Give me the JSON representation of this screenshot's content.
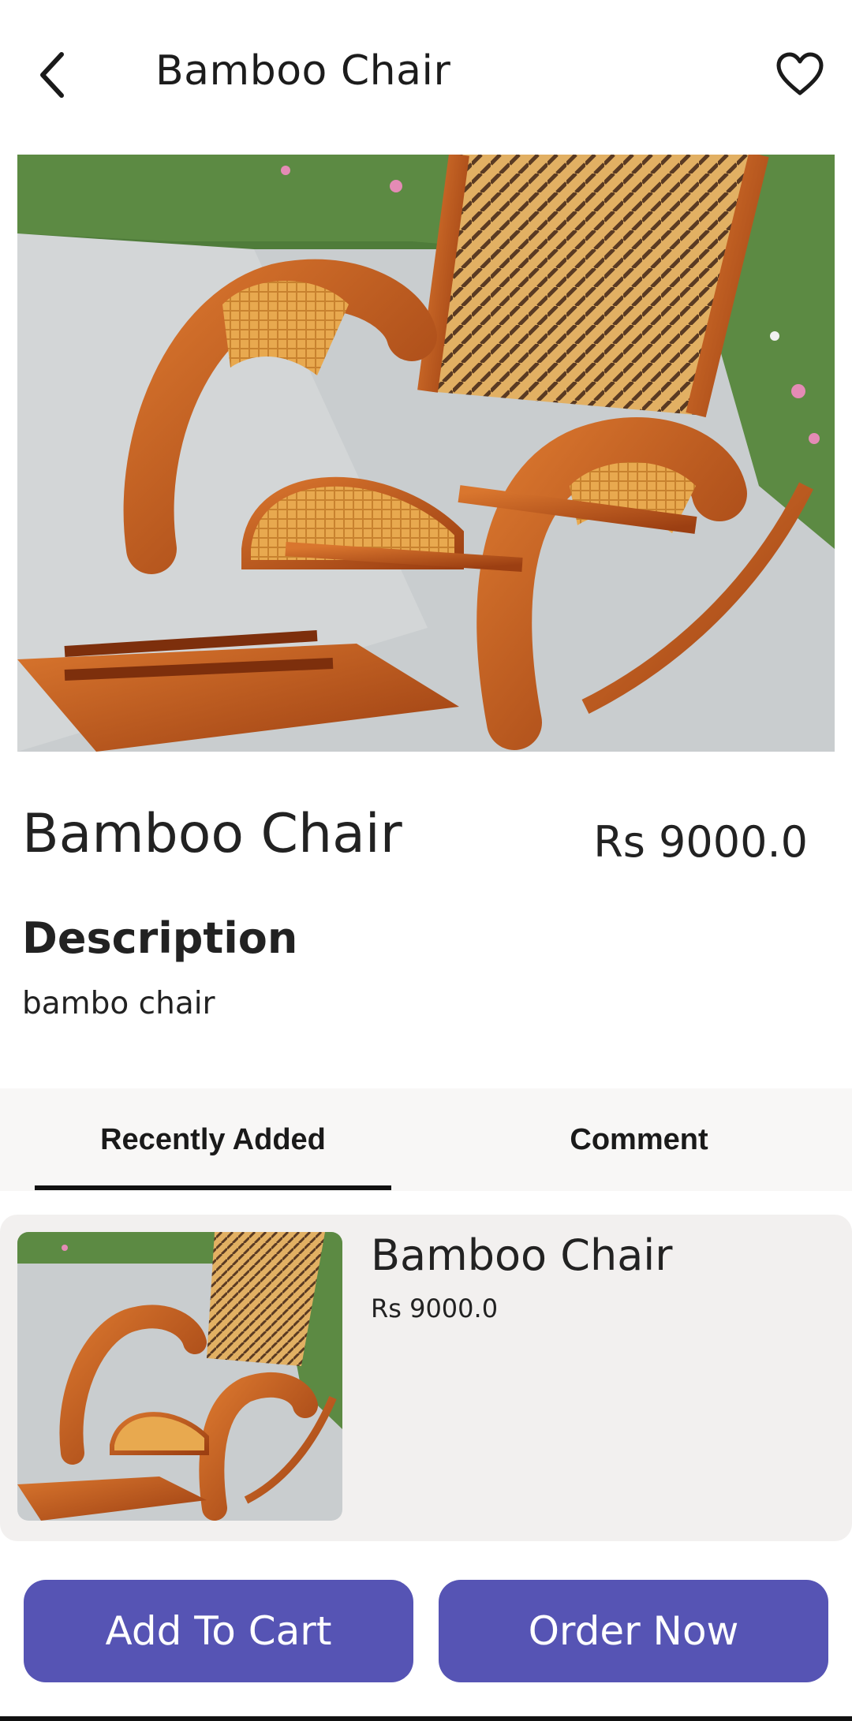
{
  "appbar": {
    "title": "Bamboo Chair",
    "back_icon": "chevron-left-icon",
    "favorite_icon": "heart-outline-icon"
  },
  "product": {
    "name": "Bamboo Chair",
    "price": "Rs 9000.0",
    "image_alt": "rocking chair photo"
  },
  "description": {
    "heading": "Description",
    "text": "bambo chair"
  },
  "tabs": [
    {
      "label": "Recently Added",
      "selected": true
    },
    {
      "label": "Comment",
      "selected": false
    }
  ],
  "recent_items": [
    {
      "name": "Bamboo Chair",
      "price": "Rs 9000.0"
    }
  ],
  "actions": {
    "add_to_cart": "Add To Cart",
    "order_now": "Order Now"
  },
  "colors": {
    "accent": "#5654b4",
    "tab_bg": "#f8f7f6",
    "card_bg": "#f2f0ef"
  }
}
